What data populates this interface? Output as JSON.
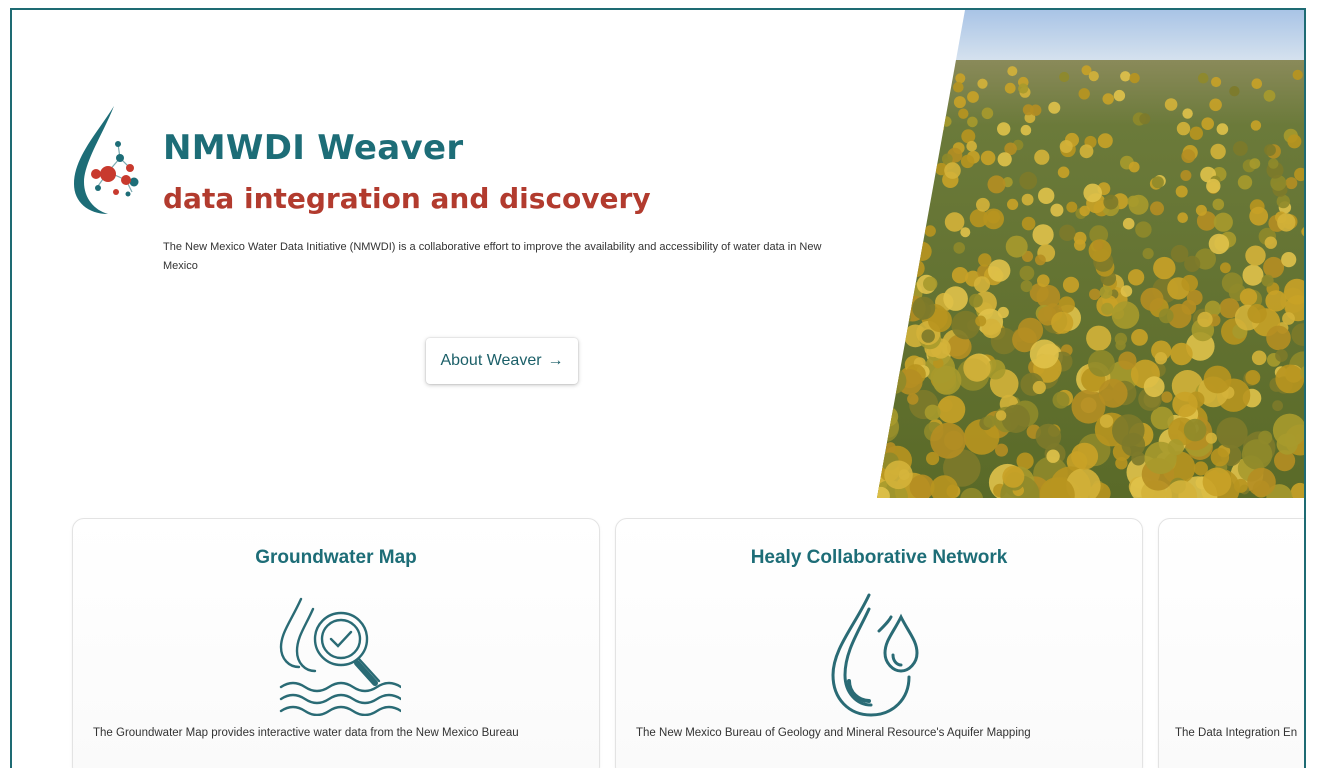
{
  "hero": {
    "title": "NMWDI Weaver",
    "subtitle": "data integration and discovery",
    "description": "The New Mexico Water Data Initiative (NMWDI) is a collaborative effort to improve the availability and accessibility of water data in New Mexico",
    "about_button_label": "About Weaver",
    "about_button_arrow": "→"
  },
  "cards": [
    {
      "title": "Groundwater Map",
      "icon": "water-drops-magnifier-icon",
      "description": "The Groundwater Map provides interactive water data from the New Mexico Bureau"
    },
    {
      "title": "Healy Collaborative Network",
      "icon": "water-drops-icon",
      "description": "The New Mexico Bureau of Geology and Mineral Resource's Aquifer Mapping"
    },
    {
      "title": "",
      "icon": "",
      "description": "The Data Integration En"
    }
  ],
  "colors": {
    "brand_teal": "#1d6d77",
    "brand_red": "#b23b2e",
    "frame_border": "#1e6b73"
  }
}
